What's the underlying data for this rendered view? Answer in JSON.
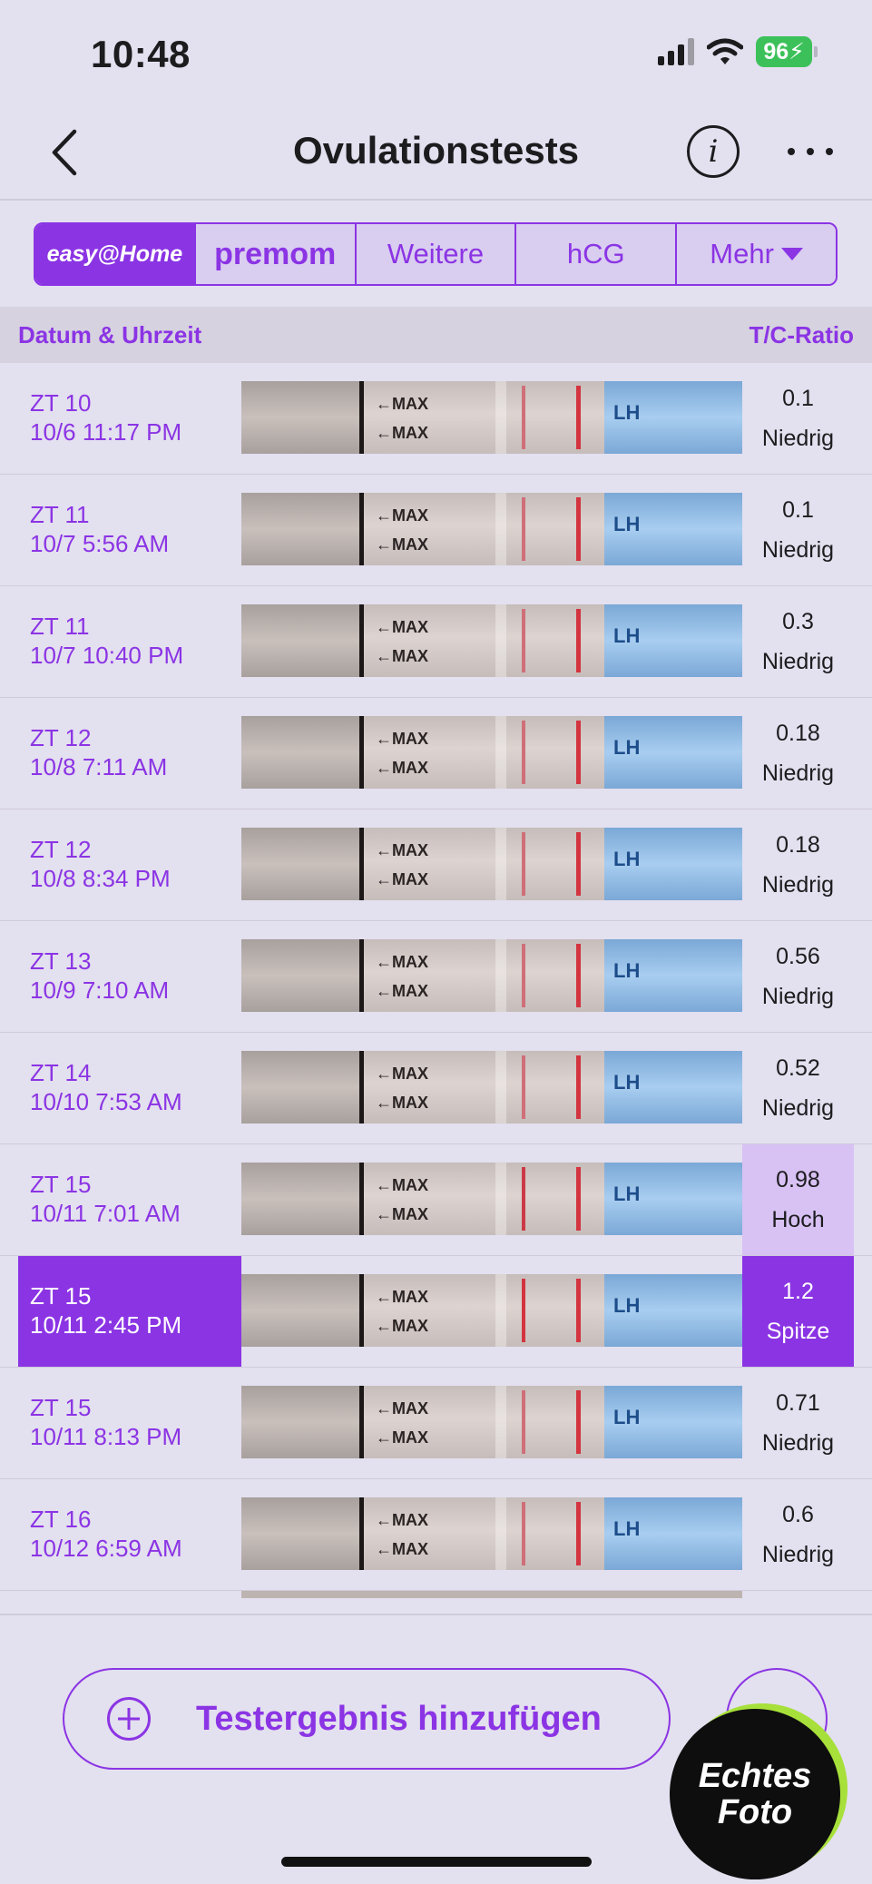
{
  "status_bar": {
    "time": "10:48",
    "battery": "96"
  },
  "nav": {
    "title": "Ovulationstests"
  },
  "brand_tabs": [
    {
      "label": "easy@Home",
      "active": true
    },
    {
      "label": "premom"
    },
    {
      "label": "Weitere"
    },
    {
      "label": "hCG"
    },
    {
      "label": "Mehr"
    }
  ],
  "table": {
    "header_left": "Datum & Uhrzeit",
    "header_right": "T/C-Ratio",
    "rows": [
      {
        "cycle_day": "ZT 10",
        "datetime": "10/6 11:17 PM",
        "ratio": "0.1",
        "level": "Niedrig"
      },
      {
        "cycle_day": "ZT 11",
        "datetime": "10/7 5:56 AM",
        "ratio": "0.1",
        "level": "Niedrig"
      },
      {
        "cycle_day": "ZT 11",
        "datetime": "10/7 10:40 PM",
        "ratio": "0.3",
        "level": "Niedrig"
      },
      {
        "cycle_day": "ZT 12",
        "datetime": "10/8 7:11 AM",
        "ratio": "0.18",
        "level": "Niedrig"
      },
      {
        "cycle_day": "ZT 12",
        "datetime": "10/8 8:34 PM",
        "ratio": "0.18",
        "level": "Niedrig"
      },
      {
        "cycle_day": "ZT 13",
        "datetime": "10/9 7:10 AM",
        "ratio": "0.56",
        "level": "Niedrig"
      },
      {
        "cycle_day": "ZT 14",
        "datetime": "10/10 7:53 AM",
        "ratio": "0.52",
        "level": "Niedrig"
      },
      {
        "cycle_day": "ZT 15",
        "datetime": "10/11 7:01 AM",
        "ratio": "0.98",
        "level": "Hoch"
      },
      {
        "cycle_day": "ZT 15",
        "datetime": "10/11 2:45 PM",
        "ratio": "1.2",
        "level": "Spitze"
      },
      {
        "cycle_day": "ZT 15",
        "datetime": "10/11 8:13 PM",
        "ratio": "0.71",
        "level": "Niedrig"
      },
      {
        "cycle_day": "ZT 16",
        "datetime": "10/12 6:59 AM",
        "ratio": "0.6",
        "level": "Niedrig"
      }
    ]
  },
  "strip_labels": {
    "max": "←MAX",
    "wrapper": "LH"
  },
  "add_button": {
    "label": "Testergebnis hinzufügen"
  },
  "badge": {
    "line1": "Echtes",
    "line2": "Foto"
  },
  "colors": {
    "accent": "#8b34e4",
    "high": "#d8c1f3",
    "background": "#e3e0ef"
  }
}
